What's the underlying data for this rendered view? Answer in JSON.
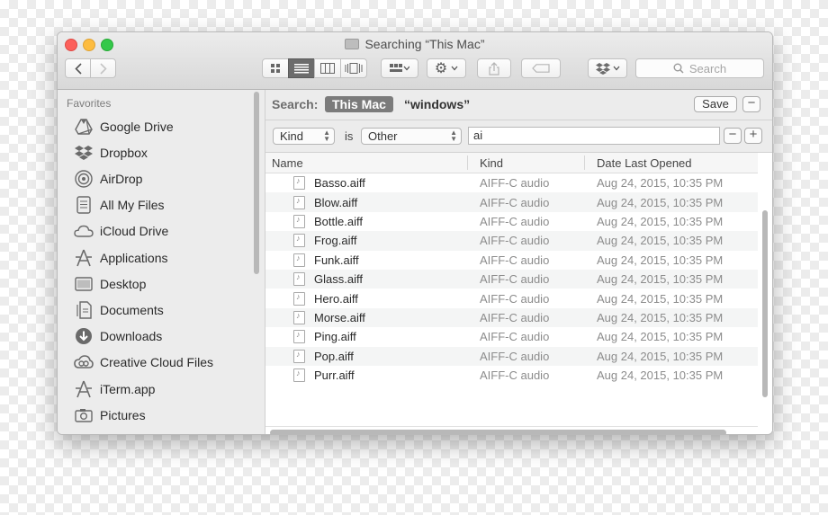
{
  "window": {
    "title": "Searching “This Mac”"
  },
  "toolbar": {
    "search_placeholder": "Search"
  },
  "sidebar": {
    "header": "Favorites",
    "items": [
      {
        "label": "Google Drive",
        "icon": "google-drive-icon"
      },
      {
        "label": "Dropbox",
        "icon": "dropbox-icon"
      },
      {
        "label": "AirDrop",
        "icon": "airdrop-icon"
      },
      {
        "label": "All My Files",
        "icon": "all-files-icon"
      },
      {
        "label": "iCloud Drive",
        "icon": "cloud-icon"
      },
      {
        "label": "Applications",
        "icon": "applications-icon"
      },
      {
        "label": "Desktop",
        "icon": "desktop-icon"
      },
      {
        "label": "Documents",
        "icon": "documents-icon"
      },
      {
        "label": "Downloads",
        "icon": "downloads-icon"
      },
      {
        "label": "Creative Cloud Files",
        "icon": "creative-cloud-icon"
      },
      {
        "label": "iTerm.app",
        "icon": "applications-icon"
      },
      {
        "label": "Pictures",
        "icon": "camera-icon"
      }
    ]
  },
  "search": {
    "label": "Search:",
    "scope_active": "This Mac",
    "scope_other": "“windows”",
    "save_label": "Save",
    "minus_label": "−"
  },
  "criteria": {
    "attribute": "Kind",
    "operator": "is",
    "value_type": "Other",
    "value_text": "ai",
    "minus_label": "−",
    "plus_label": "+"
  },
  "table": {
    "columns": [
      "Name",
      "Kind",
      "Date Last Opened"
    ],
    "rows": [
      {
        "name": "Basso.aiff",
        "kind": "AIFF-C audio",
        "date": "Aug 24, 2015, 10:35 PM"
      },
      {
        "name": "Blow.aiff",
        "kind": "AIFF-C audio",
        "date": "Aug 24, 2015, 10:35 PM"
      },
      {
        "name": "Bottle.aiff",
        "kind": "AIFF-C audio",
        "date": "Aug 24, 2015, 10:35 PM"
      },
      {
        "name": "Frog.aiff",
        "kind": "AIFF-C audio",
        "date": "Aug 24, 2015, 10:35 PM"
      },
      {
        "name": "Funk.aiff",
        "kind": "AIFF-C audio",
        "date": "Aug 24, 2015, 10:35 PM"
      },
      {
        "name": "Glass.aiff",
        "kind": "AIFF-C audio",
        "date": "Aug 24, 2015, 10:35 PM"
      },
      {
        "name": "Hero.aiff",
        "kind": "AIFF-C audio",
        "date": "Aug 24, 2015, 10:35 PM"
      },
      {
        "name": "Morse.aiff",
        "kind": "AIFF-C audio",
        "date": "Aug 24, 2015, 10:35 PM"
      },
      {
        "name": "Ping.aiff",
        "kind": "AIFF-C audio",
        "date": "Aug 24, 2015, 10:35 PM"
      },
      {
        "name": "Pop.aiff",
        "kind": "AIFF-C audio",
        "date": "Aug 24, 2015, 10:35 PM"
      },
      {
        "name": "Purr.aiff",
        "kind": "AIFF-C audio",
        "date": "Aug 24, 2015, 10:35 PM"
      }
    ]
  },
  "colors": {
    "close": "#fc605b",
    "minimize": "#fdbc40",
    "maximize": "#34c84a",
    "scope_bg": "#7b7b7b"
  }
}
